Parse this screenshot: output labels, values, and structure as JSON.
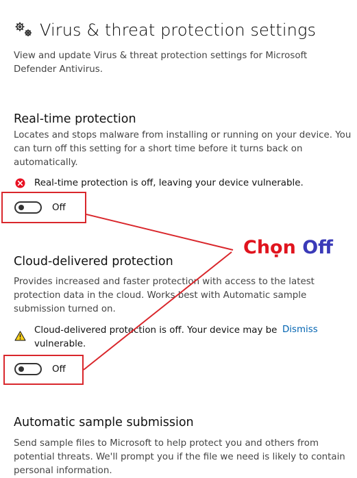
{
  "header": {
    "title": "Virus & threat protection settings",
    "icon": "gear-icon"
  },
  "intro": "View and update Virus & threat protection settings for Microsoft Defender Antivirus.",
  "realtime": {
    "title": "Real-time protection",
    "description": "Locates and stops malware from installing or running on your device. You can turn off this setting for a short time before it turns back on automatically.",
    "status": "Real-time protection is off, leaving your device vulnerable.",
    "status_icon": "error-icon",
    "toggle_label": "Off",
    "toggle_on": false
  },
  "cloud": {
    "title": "Cloud-delivered protection",
    "description": "Provides increased and faster protection with access to the latest protection data in the cloud. Works best with Automatic sample submission turned on.",
    "status": "Cloud-delivered protection is off. Your device may be vulnerable.",
    "status_icon": "warning-icon",
    "dismiss_label": "Dismiss",
    "toggle_label": "Off",
    "toggle_on": false
  },
  "sample": {
    "title": "Automatic sample submission",
    "description": "Send sample files to Microsoft to help protect you and others from potential threats. We'll prompt you if the file we need is likely to contain personal information."
  },
  "annotation": {
    "word1": "Chọn",
    "word2": "Off",
    "color1": "#e0141e",
    "color2": "#3a3ab8",
    "box_color": "#d9262b"
  },
  "colors": {
    "error": "#e81123",
    "warning": "#fcd116",
    "link": "#0063b1"
  }
}
